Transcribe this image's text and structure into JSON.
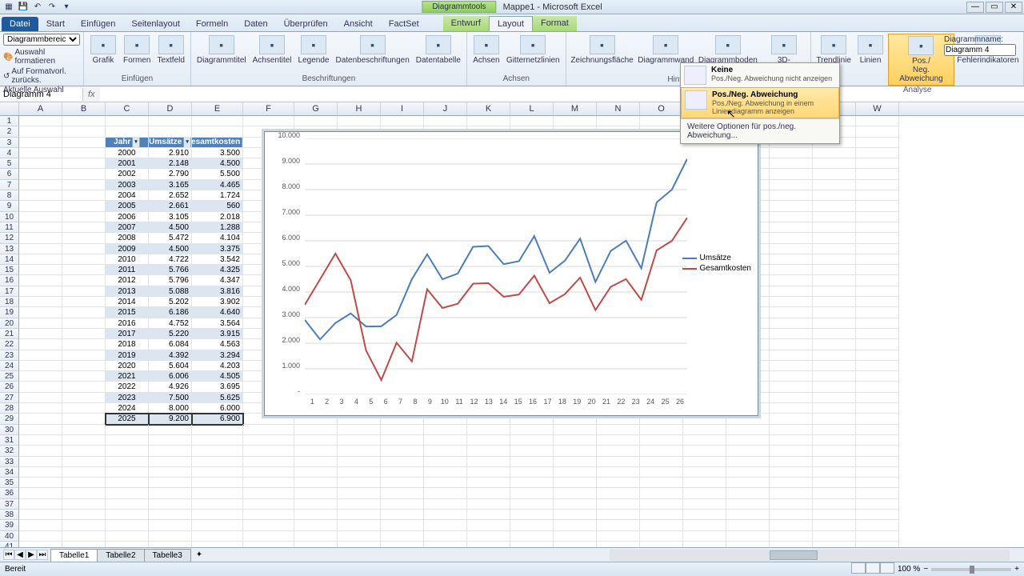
{
  "app": {
    "title": "Mappe1 - Microsoft Excel",
    "context_tool": "Diagrammtools"
  },
  "winbtns": {
    "min": "—",
    "max": "▭",
    "close": "✕"
  },
  "tabs": {
    "file": "Datei",
    "list": [
      "Start",
      "Einfügen",
      "Seitenlayout",
      "Formeln",
      "Daten",
      "Überprüfen",
      "Ansicht",
      "FactSet"
    ],
    "ctx": [
      "Entwurf",
      "Layout",
      "Format"
    ],
    "active": "Layout"
  },
  "selection_group": {
    "dropdown": "Diagrammbereich",
    "format_sel": "Auswahl formatieren",
    "reset": "Auf Formatvorl. zurücks.",
    "label": "Aktuelle Auswahl"
  },
  "ribbon": {
    "insert": {
      "items": [
        "Grafik",
        "Formen",
        "Textfeld"
      ],
      "label": "Einfügen"
    },
    "labels_grp": {
      "items": [
        "Diagrammtitel",
        "Achsentitel",
        "Legende",
        "Datenbeschriftungen",
        "Datentabelle"
      ],
      "label": "Beschriftungen"
    },
    "axes_grp": {
      "items": [
        "Achsen",
        "Gitternetzlinien"
      ],
      "label": "Achsen"
    },
    "bg_grp": {
      "items": [
        "Zeichnungsfläche",
        "Diagrammwand",
        "Diagrammboden",
        "3D-Drehung"
      ],
      "label": "Hintergrund"
    },
    "analysis_grp": {
      "items": [
        "Trendlinie",
        "Linien",
        "Pos./Neg. Abweichung",
        "Fehlerindikatoren"
      ],
      "label": "Analyse",
      "active_idx": 2
    },
    "diagname_lbl": "Diagrammname:",
    "diagname_val": "Diagramm 4"
  },
  "popup": {
    "none_title": "Keine",
    "none_desc": "Pos./Neg. Abweichung nicht anzeigen",
    "updown_title": "Pos./Neg. Abweichung",
    "updown_desc1": "Pos./Neg. Abweichung in einem",
    "updown_desc2": "Liniendiagramm anzeigen",
    "more": "Weitere Optionen für pos./neg. Abweichung..."
  },
  "namebox": "Diagramm 4",
  "columns": [
    "A",
    "B",
    "C",
    "D",
    "E",
    "F",
    "G",
    "H",
    "I",
    "J",
    "K",
    "L",
    "M",
    "N",
    "O",
    "P",
    "T",
    "U",
    "V",
    "W"
  ],
  "table": {
    "headers": [
      "Jahr",
      "Umsätze",
      "Gesamtkosten"
    ],
    "rows": [
      [
        "2000",
        "2.910",
        "3.500"
      ],
      [
        "2001",
        "2.148",
        "4.500"
      ],
      [
        "2002",
        "2.790",
        "5.500"
      ],
      [
        "2003",
        "3.165",
        "4.465"
      ],
      [
        "2004",
        "2.652",
        "1.724"
      ],
      [
        "2005",
        "2.661",
        "560"
      ],
      [
        "2006",
        "3.105",
        "2.018"
      ],
      [
        "2007",
        "4.500",
        "1.288"
      ],
      [
        "2008",
        "5.472",
        "4.104"
      ],
      [
        "2009",
        "4.500",
        "3.375"
      ],
      [
        "2010",
        "4.722",
        "3.542"
      ],
      [
        "2011",
        "5.766",
        "4.325"
      ],
      [
        "2012",
        "5.796",
        "4.347"
      ],
      [
        "2013",
        "5.088",
        "3.816"
      ],
      [
        "2014",
        "5.202",
        "3.902"
      ],
      [
        "2015",
        "6.186",
        "4.640"
      ],
      [
        "2016",
        "4.752",
        "3.564"
      ],
      [
        "2017",
        "5.220",
        "3.915"
      ],
      [
        "2018",
        "6.084",
        "4.563"
      ],
      [
        "2019",
        "4.392",
        "3.294"
      ],
      [
        "2020",
        "5.604",
        "4.203"
      ],
      [
        "2021",
        "6.006",
        "4.505"
      ],
      [
        "2022",
        "4.926",
        "3.695"
      ],
      [
        "2023",
        "7.500",
        "5.625"
      ],
      [
        "2024",
        "8.000",
        "6.000"
      ],
      [
        "2025",
        "9.200",
        "6.900"
      ]
    ]
  },
  "chart_data": {
    "type": "line",
    "title": "",
    "xlabel": "",
    "ylabel": "",
    "x": [
      1,
      2,
      3,
      4,
      5,
      6,
      7,
      8,
      9,
      10,
      11,
      12,
      13,
      14,
      15,
      16,
      17,
      18,
      19,
      20,
      21,
      22,
      23,
      24,
      25,
      26
    ],
    "ylim": [
      0,
      10000
    ],
    "yticks": [
      "-",
      "1.000",
      "2.000",
      "3.000",
      "4.000",
      "5.000",
      "6.000",
      "7.000",
      "8.000",
      "9.000",
      "10.000"
    ],
    "series": [
      {
        "name": "Umsätze",
        "color": "#4a7ebb",
        "values": [
          2910,
          2148,
          2790,
          3165,
          2652,
          2661,
          3105,
          4500,
          5472,
          4500,
          4722,
          5766,
          5796,
          5088,
          5202,
          6186,
          4752,
          5220,
          6084,
          4392,
          5604,
          6006,
          4926,
          7500,
          8000,
          9200
        ]
      },
      {
        "name": "Gesamtkosten",
        "color": "#be4b48",
        "values": [
          3500,
          4500,
          5500,
          4465,
          1724,
          560,
          2018,
          1288,
          4104,
          3375,
          3542,
          4325,
          4347,
          3816,
          3902,
          4640,
          3564,
          3915,
          4563,
          3294,
          4203,
          4505,
          3695,
          5625,
          6000,
          6900
        ]
      }
    ]
  },
  "sheets": {
    "list": [
      "Tabelle1",
      "Tabelle2",
      "Tabelle3"
    ],
    "active": 0
  },
  "status": {
    "ready": "Bereit",
    "zoom": "100 %"
  }
}
